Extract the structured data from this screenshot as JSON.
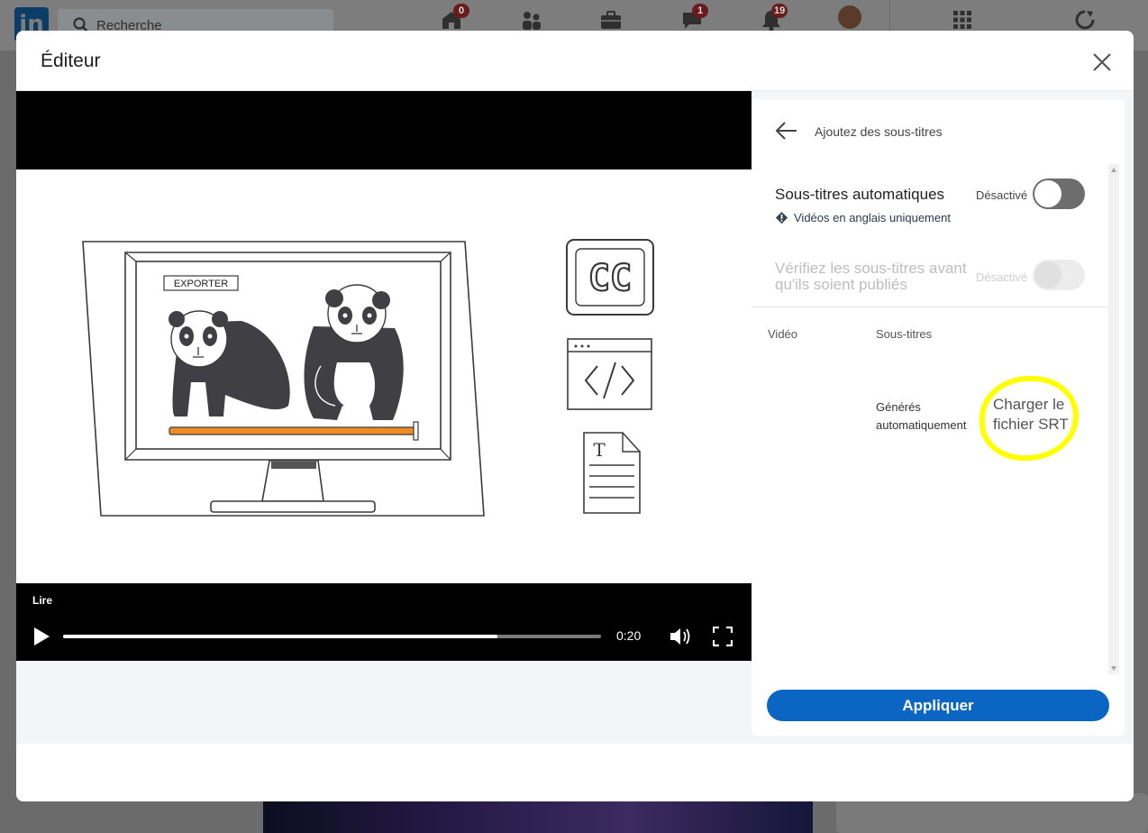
{
  "background": {
    "search_placeholder": "Recherche",
    "badges": {
      "home": "0",
      "messages": "1",
      "notifications": "19"
    }
  },
  "modal": {
    "title": "Éditeur"
  },
  "video": {
    "illustration_label": "EXPORTER",
    "overlay_label": "Lire",
    "time": "0:20",
    "progress": 0.808
  },
  "panel": {
    "heading": "Ajoutez des sous-titres",
    "auto_captions": {
      "label": "Sous-titres automatiques",
      "note": "Vidéos en anglais uniquement",
      "state": "Désactivé"
    },
    "review": {
      "label": "Vérifiez les sous-titres avant qu'ils soient publiés",
      "state": "Désactivé"
    },
    "columns": {
      "video": "Vidéo",
      "subtitles": "Sous-titres"
    },
    "generated": "Générés automatiquement",
    "upload_link": "Charger le fichier SRT",
    "apply_button": "Appliquer"
  },
  "colors": {
    "primary": "#0a66c2",
    "highlight": "#ffff00",
    "toggle_off": "#6d6d6d",
    "progress_bar": "#f08a24"
  }
}
